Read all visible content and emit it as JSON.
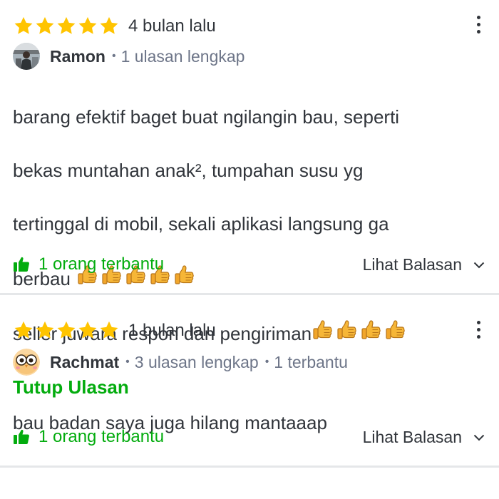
{
  "reviews": [
    {
      "rating": 5,
      "date": "4 bulan lalu",
      "user": {
        "name": "Ramon",
        "meta": "1 ulasan lengkap",
        "avatar": "photo-avatar"
      },
      "text_lines": [
        "barang efektif baget buat ngilangin bau, seperti",
        "bekas muntahan anak², tumpahan susu yg",
        "tertinggal di mobil, sekali aplikasi langsung ga",
        "berbau",
        "seller juwara respon dan pengiriman"
      ],
      "toggle_label": "Tutup Ulasan",
      "helpful_label": "1 orang terbantu",
      "replies_label": "Lihat Balasan"
    },
    {
      "rating": 5,
      "date": "1 bulan lalu",
      "user": {
        "name": "Rachmat",
        "meta": "3 ulasan lengkap",
        "meta2": "1 terbantu",
        "avatar": "owl-avatar"
      },
      "text_lines": [
        "bau badan saya juga hilang mantaaap"
      ],
      "helpful_label": "1 orang terbantu",
      "replies_label": "Lihat Balasan"
    }
  ],
  "icons": {
    "star": "star-icon",
    "more": "more-vertical-icon",
    "thumbs_up_emoji": "thumbs-up-emoji",
    "helpful": "thumbs-up-icon",
    "chevron": "chevron-down-icon"
  },
  "colors": {
    "star": "#ffc400",
    "accent_green": "#03ac0e",
    "text": "#31353b",
    "muted": "#6d7588",
    "divider": "#e5e7e9"
  }
}
